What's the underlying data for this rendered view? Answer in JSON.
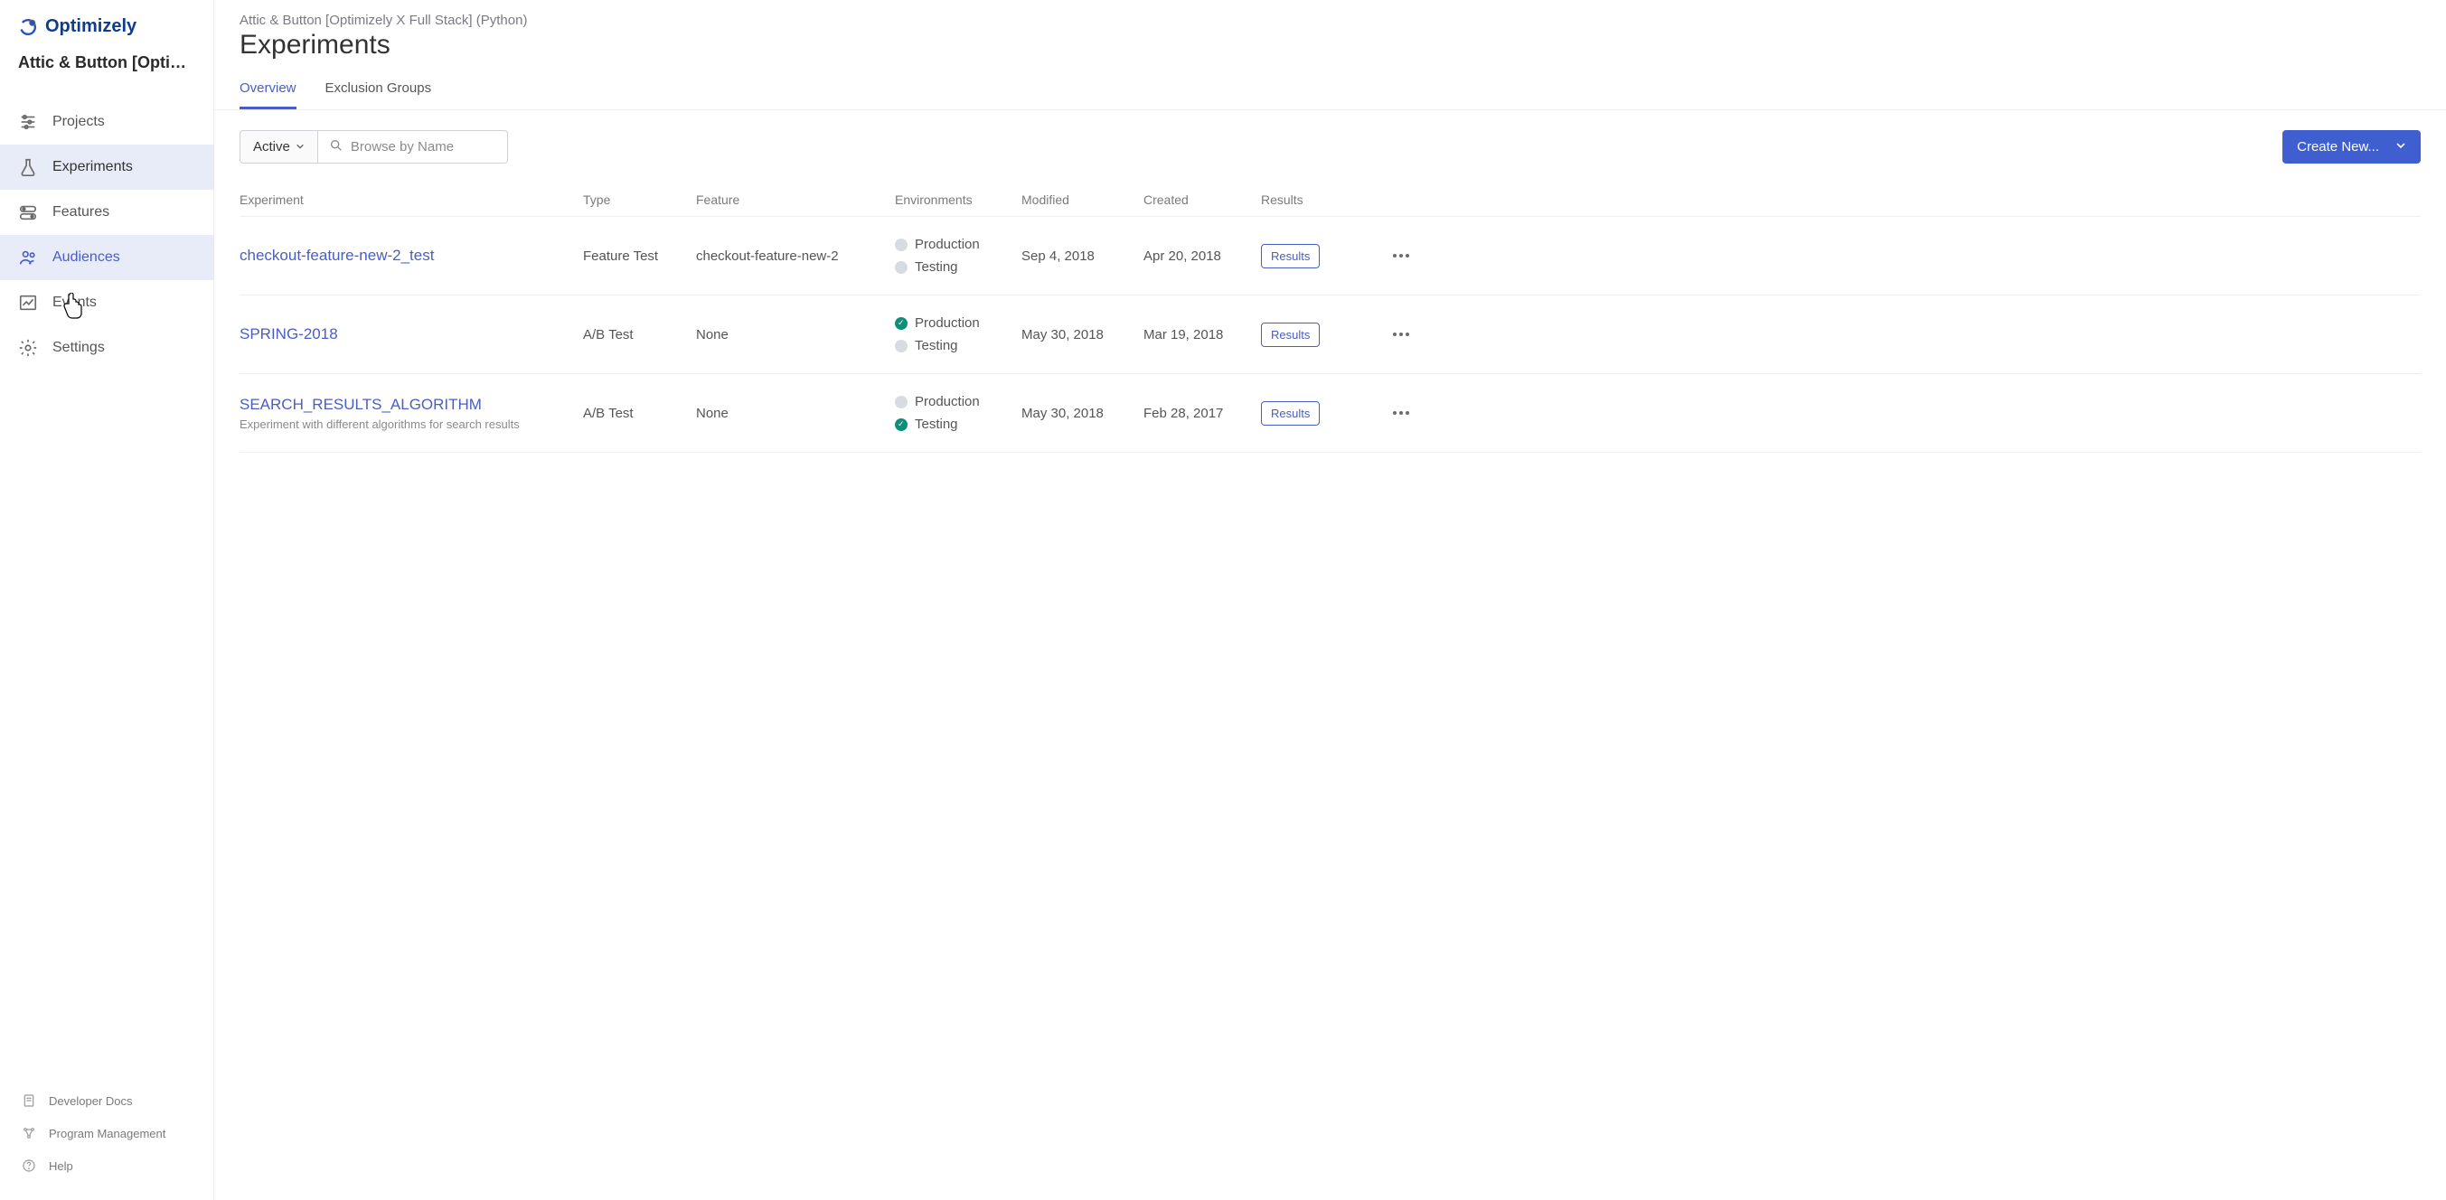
{
  "brand": "Optimizely",
  "project_name": "Attic & Button [Optim...",
  "sidebar": {
    "items": [
      {
        "label": "Projects"
      },
      {
        "label": "Experiments"
      },
      {
        "label": "Features"
      },
      {
        "label": "Audiences"
      },
      {
        "label": "Events"
      },
      {
        "label": "Settings"
      }
    ],
    "footer": [
      {
        "label": "Developer Docs"
      },
      {
        "label": "Program Management"
      },
      {
        "label": "Help"
      }
    ]
  },
  "header": {
    "breadcrumb": "Attic & Button [Optimizely X Full Stack] (Python)",
    "title": "Experiments",
    "tabs": [
      {
        "label": "Overview"
      },
      {
        "label": "Exclusion Groups"
      }
    ]
  },
  "toolbar": {
    "filter_label": "Active",
    "search_placeholder": "Browse by Name",
    "create_label": "Create New..."
  },
  "table": {
    "columns": {
      "experiment": "Experiment",
      "type": "Type",
      "feature": "Feature",
      "environments": "Environments",
      "modified": "Modified",
      "created": "Created",
      "results": "Results"
    },
    "rows": [
      {
        "name": "checkout-feature-new-2_test",
        "desc": "",
        "type": "Feature Test",
        "feature": "checkout-feature-new-2",
        "envs": [
          {
            "label": "Production",
            "on": false
          },
          {
            "label": "Testing",
            "on": false
          }
        ],
        "modified": "Sep 4, 2018",
        "created": "Apr 20, 2018",
        "results_label": "Results"
      },
      {
        "name": "SPRING-2018",
        "desc": "",
        "type": "A/B Test",
        "feature": "None",
        "envs": [
          {
            "label": "Production",
            "on": true
          },
          {
            "label": "Testing",
            "on": false
          }
        ],
        "modified": "May 30, 2018",
        "created": "Mar 19, 2018",
        "results_label": "Results"
      },
      {
        "name": "SEARCH_RESULTS_ALGORITHM",
        "desc": "Experiment with different algorithms for search results",
        "type": "A/B Test",
        "feature": "None",
        "envs": [
          {
            "label": "Production",
            "on": false
          },
          {
            "label": "Testing",
            "on": true
          }
        ],
        "modified": "May 30, 2018",
        "created": "Feb 28, 2017",
        "results_label": "Results"
      }
    ]
  }
}
